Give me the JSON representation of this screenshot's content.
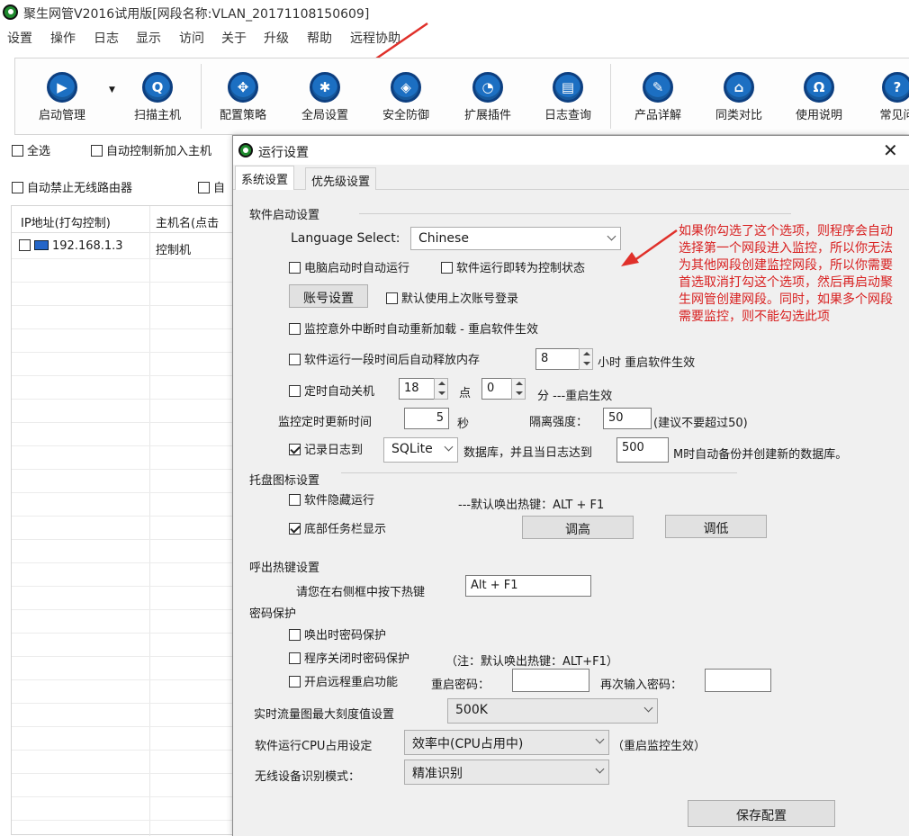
{
  "window": {
    "title": "聚生网管V2016试用版[网段名称:VLAN_20171108150609]"
  },
  "menu": [
    "设置",
    "操作",
    "日志",
    "显示",
    "访问",
    "关于",
    "升级",
    "帮助",
    "远程协助"
  ],
  "toolbar": [
    {
      "label": "启动管理",
      "icon": "play-icon"
    },
    {
      "label": "扫描主机",
      "icon": "scan-icon"
    },
    {
      "label": "配置策略",
      "icon": "policy-icon"
    },
    {
      "label": "全局设置",
      "icon": "gear-icon"
    },
    {
      "label": "安全防御",
      "icon": "shield-icon"
    },
    {
      "label": "扩展插件",
      "icon": "plugin-icon"
    },
    {
      "label": "日志查询",
      "icon": "log-icon"
    },
    {
      "label": "产品详解",
      "icon": "edit-icon"
    },
    {
      "label": "同类对比",
      "icon": "compare-icon"
    },
    {
      "label": "使用说明",
      "icon": "help-icon"
    },
    {
      "label": "常见问",
      "icon": "question-icon"
    }
  ],
  "main": {
    "select_all": "全选",
    "auto_control": "自动控制新加入主机",
    "auto_block_wifi": "自动禁止无线路由器",
    "auto_other": "自",
    "col_ip": "IP地址(打勾控制)",
    "col_host": "主机名(点击",
    "rows": [
      {
        "ip": "192.168.1.3",
        "host": "控制机"
      }
    ]
  },
  "dialog": {
    "title": "运行设置",
    "tabs": [
      "系统设置",
      "优先级设置"
    ],
    "startup": {
      "section": "软件启动设置",
      "lang_label": "Language Select:",
      "lang_value": "Chinese",
      "auto_run": "电脑启动时自动运行",
      "to_control": "软件运行即转为控制状态",
      "account_btn": "账号设置",
      "last_login": "默认使用上次账号登录",
      "auto_reload": "监控意外中断时自动重新加载 - 重启软件生效",
      "release_mem": "软件运行一段时间后自动释放内存",
      "release_hours": "8",
      "release_suffix": "小时 重启软件生效",
      "auto_shutdown": "定时自动关机",
      "hour": "18",
      "hour_unit": "点",
      "minute": "0",
      "minute_suffix": "分 ---重启生效",
      "refresh_label": "监控定时更新时间",
      "refresh_value": "5",
      "refresh_unit": "秒",
      "isolation_label": "隔离强度：",
      "isolation_value": "50",
      "isolation_hint": "(建议不要超过50)",
      "log_label": "记录日志到",
      "log_db": "SQLite",
      "log_mid": "数据库，并且当日志达到",
      "log_size": "500",
      "log_suffix": "M时自动备份并创建新的数据库。"
    },
    "tray": {
      "section": "托盘图标设置",
      "hide": "软件隐藏运行",
      "hotkey_default": "---默认唤出热键：ALT + F1",
      "taskbar": "底部任务栏显示",
      "up_btn": "调高",
      "down_btn": "调低"
    },
    "hotkey": {
      "section": "呼出热键设置",
      "prompt": "请您在右侧框中按下热键",
      "value": "Alt + F1"
    },
    "password": {
      "section": "密码保护",
      "on_show": "唤出时密码保护",
      "on_close": "程序关闭时密码保护",
      "close_note": "（注：默认唤出热键：ALT+F1）",
      "remote": "开启远程重启功能",
      "restart_pwd": "重启密码：",
      "repeat_pwd": "再次输入密码："
    },
    "traffic": {
      "label": "实时流量图最大刻度值设置",
      "value": "500K"
    },
    "cpu": {
      "label": "软件运行CPU占用设定",
      "value": "效率中(CPU占用中)",
      "note": "（重启监控生效）"
    },
    "wireless": {
      "label": "无线设备识别模式：",
      "value": "精准识别"
    },
    "save_btn": "保存配置"
  },
  "annotation": "如果你勾选了这个选项，则程序会自动选择第一个网段进入监控，所以你无法为其他网段创建监控网段，所以你需要首选取消打勾这个选项，然后再启动聚生网管创建网段。同时，如果多个网段需要监控，则不能勾选此项",
  "colors": {
    "accent": "#1c6fc2",
    "annotation": "#d82020"
  }
}
